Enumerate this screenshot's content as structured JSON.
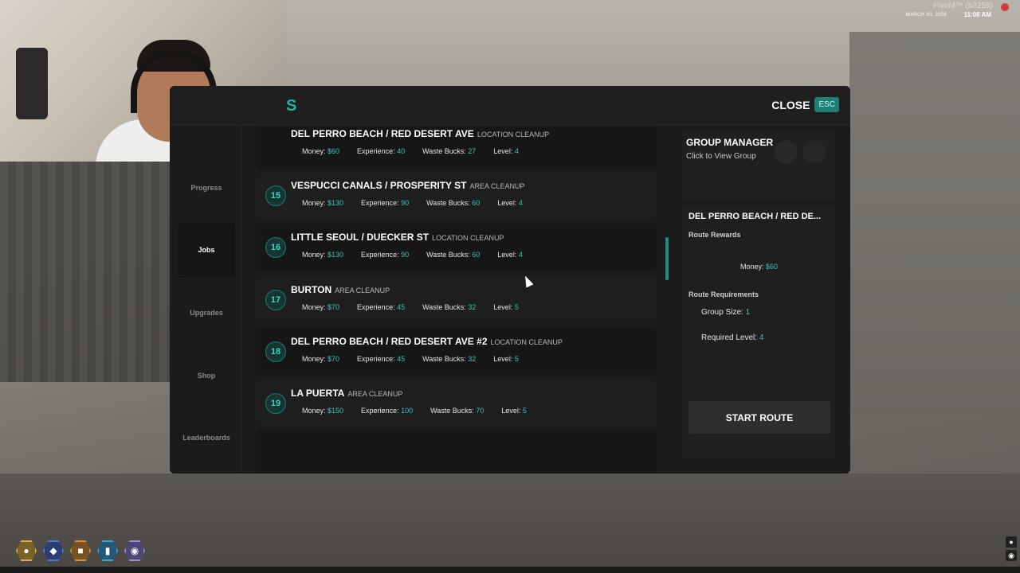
{
  "hud": {
    "server": "FiveM™ (b3258)",
    "date": "MARCH 30, 2026",
    "time": "11:08 AM"
  },
  "header": {
    "logo_letter": "S",
    "close_label": "CLOSE",
    "esc_key": "ESC"
  },
  "sidebar": {
    "items": [
      {
        "label": "Progress"
      },
      {
        "label": "Jobs"
      },
      {
        "label": "Upgrades"
      },
      {
        "label": "Shop"
      },
      {
        "label": "Leaderboards"
      }
    ],
    "active": "Jobs"
  },
  "jobs": [
    {
      "number": "",
      "title": "DEL PERRO BEACH / RED DESERT AVE",
      "type": "LOCATION CLEANUP",
      "money": "$60",
      "experience": "40",
      "waste_bucks": "27",
      "level": "4"
    },
    {
      "number": "15",
      "title": "VESPUCCI CANALS / PROSPERITY ST",
      "type": "AREA CLEANUP",
      "money": "$130",
      "experience": "90",
      "waste_bucks": "60",
      "level": "4"
    },
    {
      "number": "16",
      "title": "LITTLE SEOUL / DUECKER ST",
      "type": "LOCATION CLEANUP",
      "money": "$130",
      "experience": "90",
      "waste_bucks": "60",
      "level": "4"
    },
    {
      "number": "17",
      "title": "BURTON",
      "type": "AREA CLEANUP",
      "money": "$70",
      "experience": "45",
      "waste_bucks": "32",
      "level": "5"
    },
    {
      "number": "18",
      "title": "DEL PERRO BEACH / RED DESERT AVE #2",
      "type": "LOCATION CLEANUP",
      "money": "$70",
      "experience": "45",
      "waste_bucks": "32",
      "level": "5"
    },
    {
      "number": "19",
      "title": "LA PUERTA",
      "type": "AREA CLEANUP",
      "money": "$150",
      "experience": "100",
      "waste_bucks": "70",
      "level": "5"
    }
  ],
  "stat_labels": {
    "money": "Money: ",
    "experience": "Experience: ",
    "waste_bucks": "Waste Bucks: ",
    "level": "Level: "
  },
  "group": {
    "title": "GROUP MANAGER",
    "subtitle": "Click to View Group"
  },
  "route": {
    "name": "DEL PERRO BEACH / RED DE...",
    "rewards_heading": "Route Rewards",
    "money_label": "Money: ",
    "money_value": "$60",
    "requirements_heading": "Route Requirements",
    "group_size_label": "Group Size: ",
    "group_size_value": "1",
    "required_level_label": "Required Level: ",
    "required_level_value": "4",
    "start_label": "START ROUTE"
  },
  "colors": {
    "accent": "#39c6b4",
    "panel": "#1b1b1b"
  }
}
